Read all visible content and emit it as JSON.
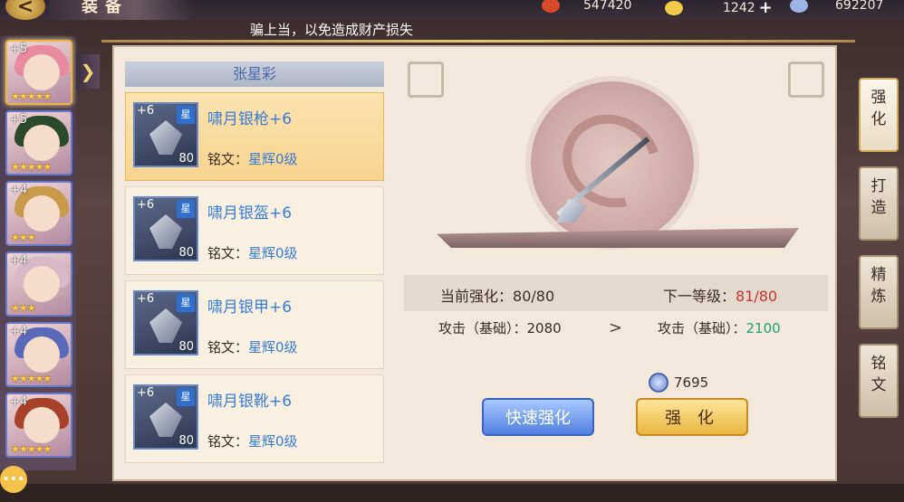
{
  "header": {
    "title": "装备",
    "back_symbol": "<",
    "resources": [
      {
        "value": "547420",
        "icon": "battle-power-icon"
      },
      {
        "value": "1242",
        "icon": "gold-ingot-icon"
      },
      {
        "value": "692207",
        "icon": "silver-coin-icon"
      }
    ]
  },
  "notice": "骗上当，以免造成财产损失",
  "heroes": [
    {
      "level": "+5",
      "stars": "★★★★★"
    },
    {
      "level": "+5",
      "stars": "★★★★★"
    },
    {
      "level": "+4",
      "stars": "★★★"
    },
    {
      "level": "+4",
      "stars": "★★★"
    },
    {
      "level": "+4",
      "stars": "★★★★★"
    },
    {
      "level": "+4",
      "stars": "★★★★★"
    }
  ],
  "equipment_list": {
    "character_name": "张星彩",
    "items": [
      {
        "name": "啸月银枪+6",
        "enhance": "+6",
        "badge": "星",
        "level": "80",
        "inscription_label": "铭文：",
        "inscription_value": "星辉0级"
      },
      {
        "name": "啸月银盔+6",
        "enhance": "+6",
        "badge": "星",
        "level": "80",
        "inscription_label": "铭文：",
        "inscription_value": "星辉0级"
      },
      {
        "name": "啸月银甲+6",
        "enhance": "+6",
        "badge": "星",
        "level": "80",
        "inscription_label": "铭文：",
        "inscription_value": "星辉0级"
      },
      {
        "name": "啸月银靴+6",
        "enhance": "+6",
        "badge": "星",
        "level": "80",
        "inscription_label": "铭文：",
        "inscription_value": "星辉0级"
      }
    ]
  },
  "stats": {
    "current_label": "当前强化：",
    "current_value": "80/80",
    "next_label": "下一等级：",
    "next_value": "81/80",
    "atk_current_label": "攻击（基础）：",
    "atk_current_value": "2080",
    "atk_next_label": "攻击（基础）：",
    "atk_next_value": "2100",
    "arrow": ">"
  },
  "cost": {
    "value": "7695"
  },
  "buttons": {
    "quick_enhance": "快速强化",
    "enhance": "强 化"
  },
  "side_tabs": [
    {
      "label": "强化"
    },
    {
      "label": "打造"
    },
    {
      "label": "精炼"
    },
    {
      "label": "铭文"
    }
  ],
  "colors": {
    "accent_blue": "#3a7bd5",
    "red_value": "#cc3333",
    "green_value": "#1f9f78",
    "gold_button": "#e9b640"
  }
}
